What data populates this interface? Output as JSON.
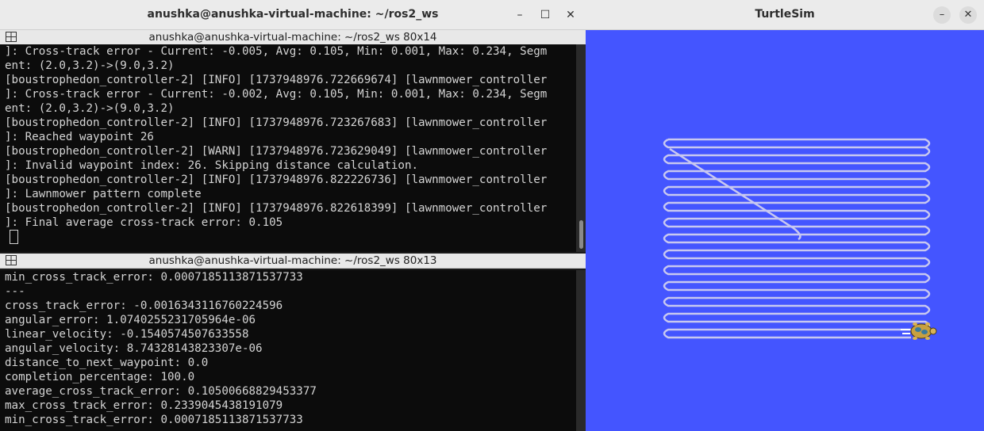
{
  "terminal": {
    "window_title": "anushka@anushka-virtual-machine: ~/ros2_ws",
    "top_pane": {
      "title": "anushka@anushka-virtual-machine: ~/ros2_ws 80x14",
      "lines": [
        "]: Cross-track error - Current: -0.005, Avg: 0.105, Min: 0.001, Max: 0.234, Segm",
        "ent: (2.0,3.2)->(9.0,3.2)",
        "[boustrophedon_controller-2] [INFO] [1737948976.722669674] [lawnmower_controller",
        "]: Cross-track error - Current: -0.002, Avg: 0.105, Min: 0.001, Max: 0.234, Segm",
        "ent: (2.0,3.2)->(9.0,3.2)",
        "[boustrophedon_controller-2] [INFO] [1737948976.723267683] [lawnmower_controller",
        "]: Reached waypoint 26",
        "[boustrophedon_controller-2] [WARN] [1737948976.723629049] [lawnmower_controller",
        "]: Invalid waypoint index: 26. Skipping distance calculation.",
        "[boustrophedon_controller-2] [INFO] [1737948976.822226736] [lawnmower_controller",
        "]: Lawnmower pattern complete",
        "[boustrophedon_controller-2] [INFO] [1737948976.822618399] [lawnmower_controller",
        "]: Final average cross-track error: 0.105"
      ]
    },
    "bottom_pane": {
      "title": "anushka@anushka-virtual-machine: ~/ros2_ws 80x13",
      "lines": [
        "min_cross_track_error: 0.0007185113871537733",
        "---",
        "cross_track_error: -0.0016343116760224596",
        "angular_error: 1.0740255231705964e-06",
        "linear_velocity: -0.1540574507633558",
        "angular_velocity: 8.74328143823307e-06",
        "distance_to_next_waypoint: 0.0",
        "completion_percentage: 100.0",
        "average_cross_track_error: 0.10500668829453377",
        "max_cross_track_error: 0.2339045438191079",
        "min_cross_track_error: 0.0007185113871537733"
      ]
    },
    "buttons": {
      "minimize": "–",
      "maximize": "☐",
      "close": "✕"
    }
  },
  "turtlesim": {
    "window_title": "TurtleSim",
    "buttons": {
      "minimize": "–",
      "close": "✕"
    },
    "colors": {
      "background": "#4455ff",
      "trail": "#c8c8f0"
    }
  }
}
